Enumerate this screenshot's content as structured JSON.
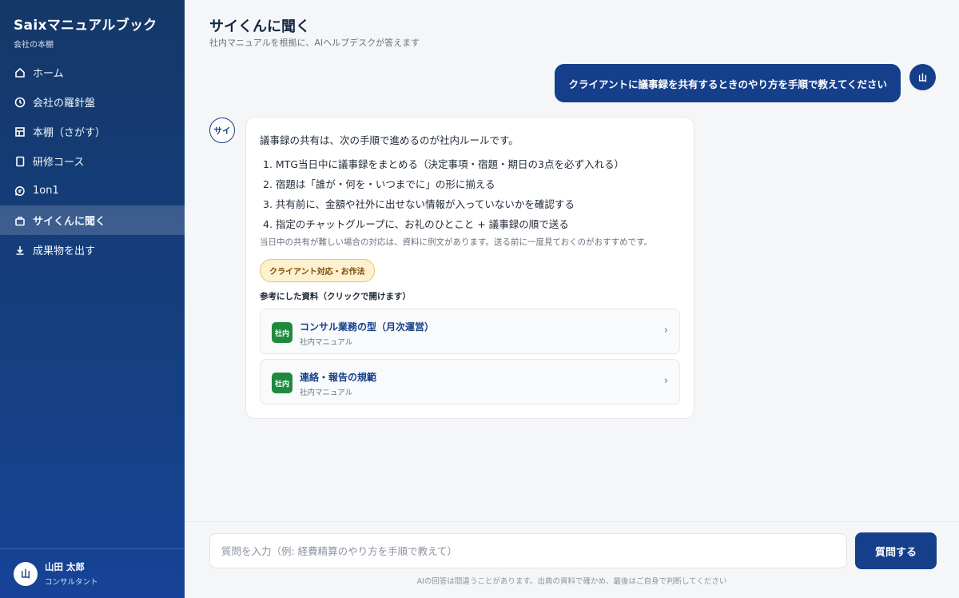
{
  "sidebar": {
    "title": "Saixマニュアルブック",
    "subtitle": "会社の本棚",
    "items": [
      {
        "label": "ホーム",
        "icon": "home-icon",
        "active": false
      },
      {
        "label": "会社の羅針盤",
        "icon": "compass-icon",
        "active": false
      },
      {
        "label": "本棚（さがす）",
        "icon": "bookshelf-icon",
        "active": false
      },
      {
        "label": "研修コース",
        "icon": "book-icon",
        "active": false
      },
      {
        "label": "1on1",
        "icon": "chat-icon",
        "active": false
      },
      {
        "label": "サイくんに聞く",
        "icon": "bag-icon",
        "active": true
      },
      {
        "label": "成果物を出す",
        "icon": "download-icon",
        "active": false
      }
    ],
    "user": {
      "avatar": "山",
      "name": "山田 太郎",
      "role": "コンサルタント"
    }
  },
  "header": {
    "title": "サイくんに聞く",
    "subtitle": "社内マニュアルを根拠に、AIヘルプデスクが答えます"
  },
  "conversation": {
    "user_avatar": "山",
    "user_message": "クライアントに議事録を共有するときのやり方を手順で教えてください",
    "bot_avatar": "サイ",
    "bot_intro": "議事録の共有は、次の手順で進めるのが社内ルールです。",
    "steps": [
      "1. MTG当日中に議事録をまとめる（決定事項・宿題・期日の3点を必ず入れる）",
      "2. 宿題は「誰が・何を・いつまでに」の形に揃える",
      "3. 共有前に、金額や社外に出せない情報が入っていないかを確認する",
      "4. 指定のチャットグループに、お礼のひとこと + 議事録の順で送る"
    ],
    "note": "当日中の共有が難しい場合の対応は、資料に例文があります。送る前に一度見ておくのがおすすめです。",
    "tag": "クライアント対応・お作法",
    "references_title": "参考にした資料（クリックで開けます）",
    "references": [
      {
        "badge": "社内",
        "title": "コンサル業務の型（月次運営）",
        "source": "社内マニュアル"
      },
      {
        "badge": "社内",
        "title": "連絡・報告の規範",
        "source": "社内マニュアル"
      }
    ]
  },
  "composer": {
    "placeholder": "質問を入力（例: 経費精算のやり方を手順で教えて）",
    "send_label": "質問する",
    "disclaimer": "AIの回答は間違うことがあります。出典の資料で確かめ、最後はご自身で判断してください"
  },
  "colors": {
    "sidebar_bg": "#153f7f",
    "accent": "#153f8a",
    "badge_green": "#1f8a3e",
    "tag_bg": "#fdf1cf"
  }
}
